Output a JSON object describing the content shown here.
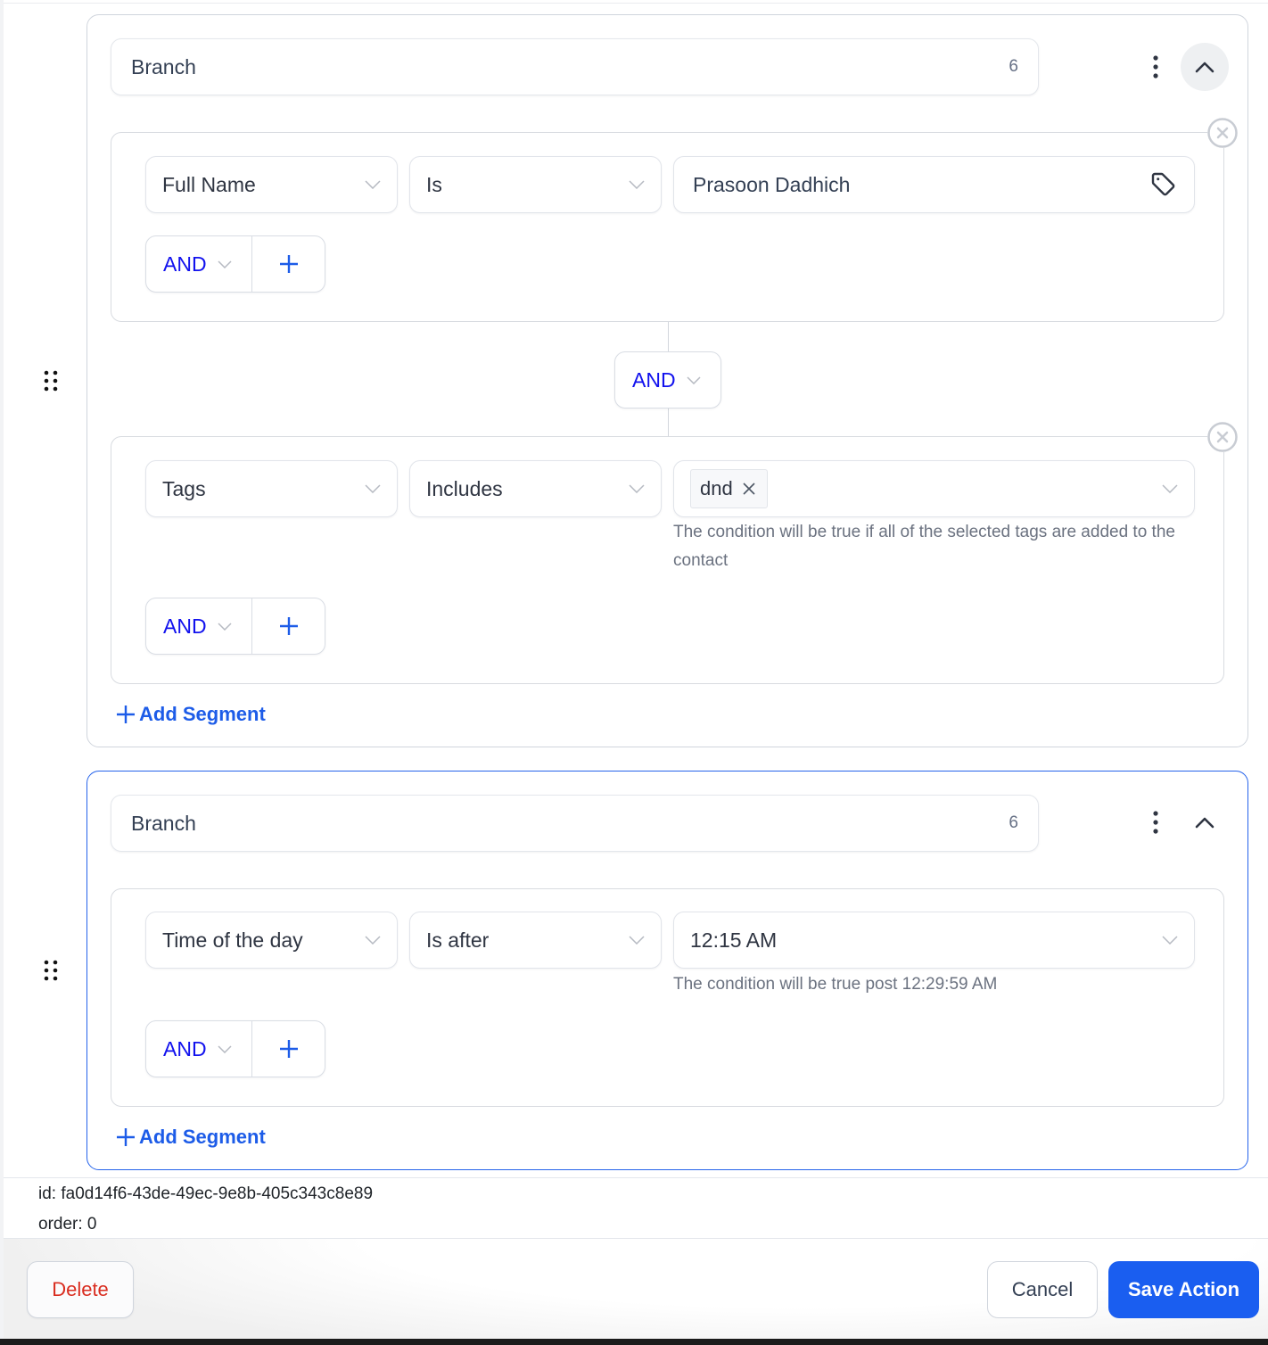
{
  "colors": {
    "primary": "#1a5ef0",
    "link": "#1d5ce8",
    "logic_operator": "#1111ee",
    "danger": "#d92d20",
    "active_border": "#2563eb"
  },
  "branches": [
    {
      "name": "Branch",
      "count": "6",
      "segments": [
        {
          "field": "Full Name",
          "operator": "Is",
          "value": "Prasoon Dadhich",
          "value_icon": "tag-icon",
          "hint": "",
          "logic": "AND"
        },
        {
          "field": "Tags",
          "operator": "Includes",
          "value_chips": [
            "dnd"
          ],
          "hint": "The condition will be true if all of the selected tags are added to the contact",
          "logic": "AND"
        }
      ],
      "segment_joiner": "AND",
      "add_segment_label": "Add Segment"
    },
    {
      "name": "Branch",
      "count": "6",
      "segments": [
        {
          "field": "Time of the day",
          "operator": "Is after",
          "value": "12:15 AM",
          "hint": "The condition will be true post 12:29:59 AM",
          "logic": "AND"
        }
      ],
      "add_segment_label": "Add Segment"
    }
  ],
  "meta": {
    "id_line": "id: fa0d14f6-43de-49ec-9e8b-405c343c8e89",
    "order_line": "order: 0"
  },
  "footer": {
    "delete_label": "Delete",
    "cancel_label": "Cancel",
    "save_label": "Save Action"
  }
}
